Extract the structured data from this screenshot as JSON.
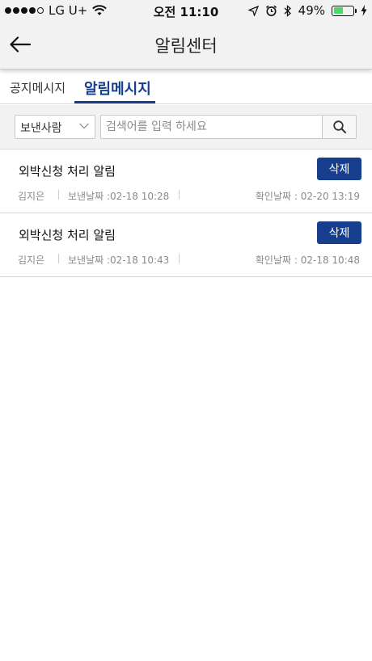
{
  "status_bar": {
    "carrier": "LG U+",
    "time": "오전 11:10",
    "battery": "49%",
    "battery_level": 0.49,
    "battery_color": "#4cd964"
  },
  "header": {
    "title": "알림센터",
    "back_icon": "arrow-left-icon"
  },
  "tabs": [
    {
      "label": "공지메시지",
      "active": false
    },
    {
      "label": "알림메시지",
      "active": true
    }
  ],
  "search": {
    "select_value": "보낸사람",
    "placeholder": "검색어를 입력 하세요",
    "button_icon": "search-icon"
  },
  "messages": [
    {
      "title": "외박신청 처리 알림",
      "delete_label": "삭제",
      "sender": "김지은",
      "sent": "보낸날짜 :02-18 10:28",
      "confirmed": "확인날짜 : 02-20 13:19"
    },
    {
      "title": "외박신청 처리 알림",
      "delete_label": "삭제",
      "sender": "김지은",
      "sent": "보낸날짜 :02-18 10:43",
      "confirmed": "확인날짜 : 02-18 10:48"
    }
  ],
  "colors": {
    "accent": "#173e8d",
    "header_bg": "#f2f2f2"
  }
}
